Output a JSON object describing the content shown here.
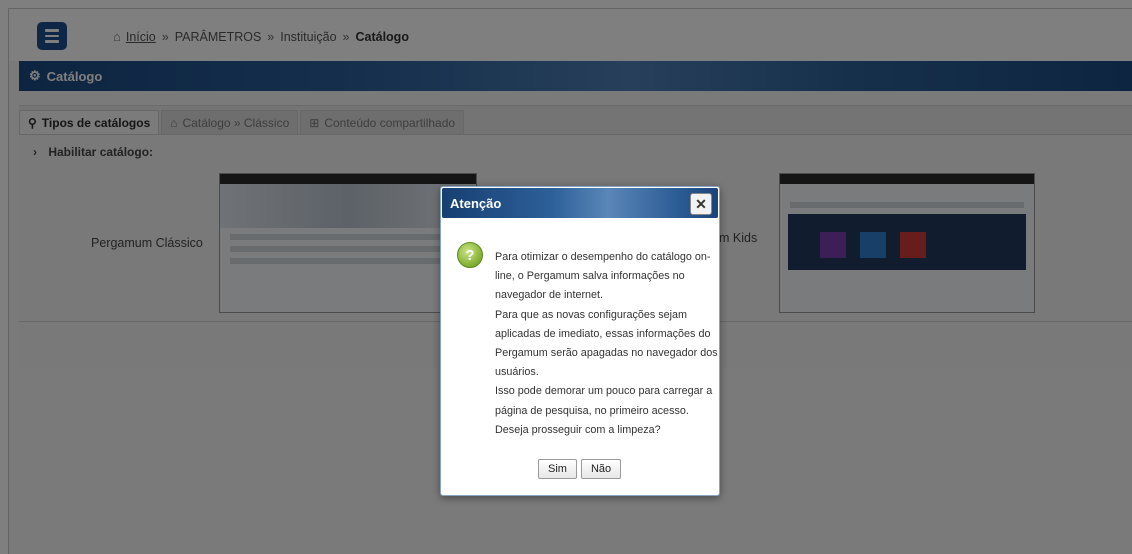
{
  "breadcrumb": {
    "home": "Início",
    "items": [
      "PARÂMETROS",
      "Instituição"
    ],
    "current": "Catálogo",
    "separator": "»"
  },
  "section": {
    "title": "Catálogo",
    "icon": "cogs-icon"
  },
  "tabs": [
    {
      "label": "Tipos de catálogos",
      "icon": "search-icon",
      "active": true
    },
    {
      "label": "Catálogo » Clássico",
      "icon": "bank-icon",
      "active": false
    },
    {
      "label": "Conteúdo compartilhado",
      "icon": "sitemap-icon",
      "active": false
    }
  ],
  "content": {
    "enable_heading": "Habilitar catálogo:",
    "option_classic": "Pergamum Clássico",
    "option_kids": "m Kids"
  },
  "dialog": {
    "title": "Atenção",
    "icon": "help-icon",
    "lines": [
      "Para otimizar o desempenho do catálogo on-",
      "line, o Pergamum salva informações no",
      "navegador de internet.",
      "Para que as novas configurações sejam",
      "aplicadas de imediato, essas informações do",
      "Pergamum serão apagadas no navegador dos",
      "usuários.",
      "Isso pode demorar um pouco para carregar a",
      "página de pesquisa, no primeiro acesso.",
      "Deseja prosseguir com a limpeza?"
    ],
    "yes": "Sim",
    "no": "Não"
  },
  "colors": {
    "header_blue": "#1f4f8c",
    "overlay": "rgba(0,0,0,0.5)"
  }
}
